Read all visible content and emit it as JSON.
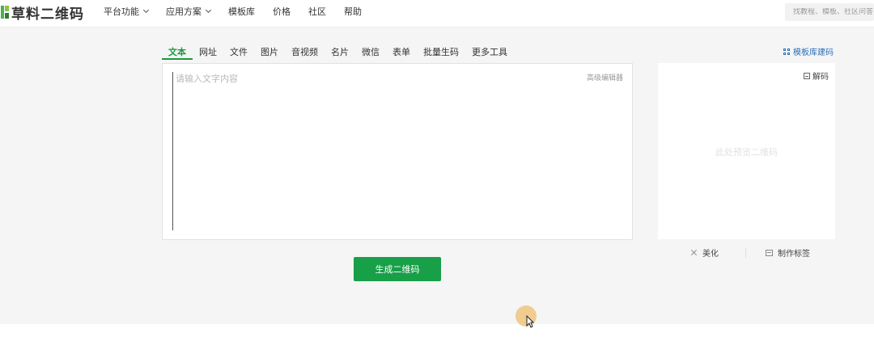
{
  "header": {
    "logo_text": "草料二维码",
    "nav": [
      {
        "label": "平台功能",
        "has_dropdown": true
      },
      {
        "label": "应用方案",
        "has_dropdown": true
      },
      {
        "label": "模板库",
        "has_dropdown": false
      },
      {
        "label": "价格",
        "has_dropdown": false
      },
      {
        "label": "社区",
        "has_dropdown": false
      },
      {
        "label": "帮助",
        "has_dropdown": false
      }
    ],
    "search_placeholder": "找教程、模板、社区问答"
  },
  "tabs": [
    {
      "label": "文本",
      "active": true
    },
    {
      "label": "网址",
      "active": false
    },
    {
      "label": "文件",
      "active": false
    },
    {
      "label": "图片",
      "active": false
    },
    {
      "label": "音视频",
      "active": false
    },
    {
      "label": "名片",
      "active": false
    },
    {
      "label": "微信",
      "active": false
    },
    {
      "label": "表单",
      "active": false
    },
    {
      "label": "批量生码",
      "active": false
    },
    {
      "label": "更多工具",
      "active": false
    }
  ],
  "template_link": "模板库建码",
  "editor": {
    "placeholder": "请输入文字内容",
    "value": "",
    "advanced_editor": "高级编辑器"
  },
  "preview": {
    "decode_label": "解码",
    "placeholder_text": "此处预览二维码",
    "beautify_label": "美化",
    "make_label_label": "制作标签"
  },
  "generate_button": "生成二维码",
  "colors": {
    "accent": "#18a048",
    "link": "#2a6fb8",
    "background": "#f5f5f5"
  }
}
